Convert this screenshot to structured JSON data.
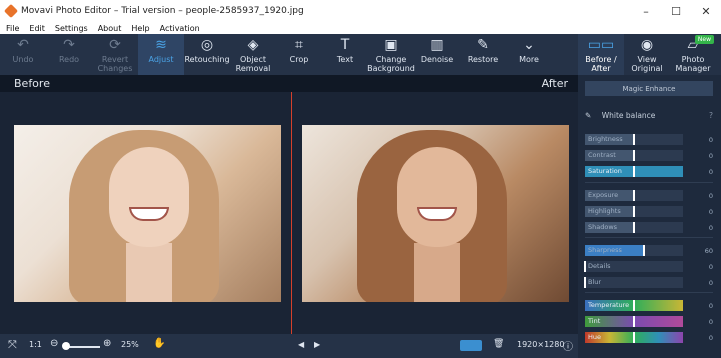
{
  "window": {
    "title": "Movavi Photo Editor – Trial version – people-2585937_1920.jpg",
    "controls": [
      "–",
      "☐",
      "✕"
    ]
  },
  "menu": [
    "File",
    "Edit",
    "Settings",
    "About",
    "Help",
    "Activation"
  ],
  "toolbar": [
    {
      "label": "Undo",
      "icon": "undo-icon",
      "glyph": "↶",
      "state": "disabled"
    },
    {
      "label": "Redo",
      "icon": "redo-icon",
      "glyph": "↷",
      "state": "disabled"
    },
    {
      "label": "Revert\nChanges",
      "icon": "revert-icon",
      "glyph": "⟳",
      "state": "disabled"
    },
    {
      "label": "Adjust",
      "icon": "adjust-icon",
      "glyph": "≋",
      "state": "active"
    },
    {
      "label": "Retouching",
      "icon": "retouching-icon",
      "glyph": "◎",
      "state": "normal"
    },
    {
      "label": "Object\nRemoval",
      "icon": "object-removal-icon",
      "glyph": "◈",
      "state": "normal"
    },
    {
      "label": "Crop",
      "icon": "crop-icon",
      "glyph": "⌗",
      "state": "normal"
    },
    {
      "label": "Text",
      "icon": "text-icon",
      "glyph": "T",
      "state": "normal"
    },
    {
      "label": "Change\nBackground",
      "icon": "change-background-icon",
      "glyph": "▣",
      "state": "normal"
    },
    {
      "label": "Denoise",
      "icon": "denoise-icon",
      "glyph": "▥",
      "state": "normal"
    },
    {
      "label": "Restore",
      "icon": "restore-icon",
      "glyph": "✎",
      "state": "normal"
    },
    {
      "label": "More",
      "icon": "chevron-down-icon",
      "glyph": "⌄",
      "state": "normal"
    }
  ],
  "view_buttons": [
    {
      "label": "Before /\nAfter",
      "icon": "before-after-icon",
      "glyph": "▭▭",
      "state": "selected"
    },
    {
      "label": "View\nOriginal",
      "icon": "eye-icon",
      "glyph": "◉",
      "state": "normal"
    },
    {
      "label": "Photo\nManager",
      "icon": "photo-manager-icon",
      "glyph": "▱",
      "state": "normal",
      "badge": "New"
    }
  ],
  "compare": {
    "before_label": "Before",
    "after_label": "After"
  },
  "bottom": {
    "fit_glyph": "⤧",
    "actual_size": "1:1",
    "zoom_out": "⊖",
    "zoom_in": "⊕",
    "zoom": "25%",
    "hand_glyph": "✋",
    "prev": "◀",
    "next": "▶",
    "trash_glyph": "🗑",
    "resolution": "1920×1280",
    "info_glyph": "ⓘ"
  },
  "sidebar": {
    "magic_enhance": "Magic Enhance",
    "white_balance": "White balance",
    "help_glyph": "?",
    "sliders": [
      {
        "label": "Brightness",
        "value": "0",
        "level": 0.5
      },
      {
        "label": "Contrast",
        "value": "0",
        "level": 0.5
      },
      {
        "label": "Saturation",
        "value": "0",
        "level": 0.5
      },
      {
        "label": "Exposure",
        "value": "0",
        "level": 0.5
      },
      {
        "label": "Highlights",
        "value": "0",
        "level": 0.5
      },
      {
        "label": "Shadows",
        "value": "0",
        "level": 0.5
      },
      {
        "label": "Sharpness",
        "value": "60",
        "level": 0.6
      },
      {
        "label": "Details",
        "value": "0",
        "level": 0.0
      },
      {
        "label": "Blur",
        "value": "0",
        "level": 0.0
      },
      {
        "label": "Temperature",
        "value": "0",
        "level": 0.5
      },
      {
        "label": "Tint",
        "value": "0",
        "level": 0.5
      },
      {
        "label": "Hue",
        "value": "0",
        "level": 0.5
      }
    ]
  },
  "colors": {
    "accent": "#4aa3e6",
    "divider": "#d5402b",
    "badge": "#34b54a",
    "background": "#1b2535"
  }
}
